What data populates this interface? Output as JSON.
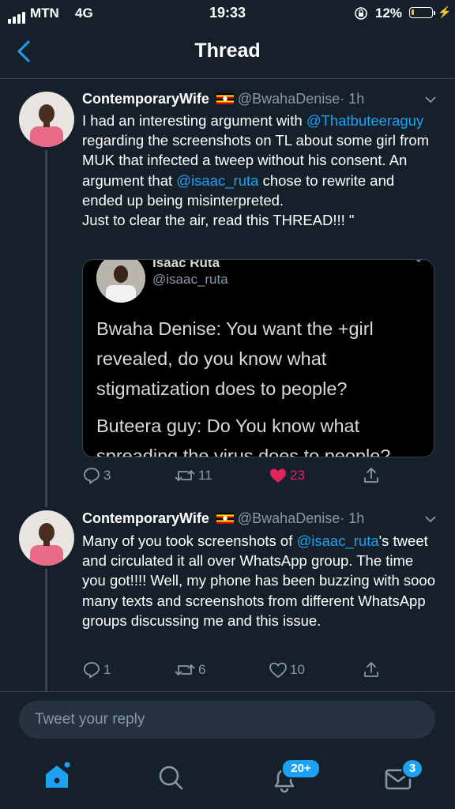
{
  "status_bar": {
    "carrier": "MTN",
    "network": "4G",
    "time": "19:33",
    "battery_percent": "12%",
    "battery_level": 0.12
  },
  "header": {
    "title": "Thread"
  },
  "tweets": [
    {
      "display_name": "ContemporaryWife",
      "handle": "@BwahaDenise",
      "time": "· 1h",
      "text_segments": [
        {
          "t": "I had an interesting argument with "
        },
        {
          "t": "@Thatbuteeraguy",
          "mention": true
        },
        {
          "t": " regarding the screenshots on TL about some girl from MUK that infected a tweep without his consent. An argument that "
        },
        {
          "t": "@isaac_ruta",
          "mention": true
        },
        {
          "t": " chose to rewrite and ended up being misinterpreted."
        }
      ],
      "text_last_line": "Just to clear the air, read this THREAD!!! \"",
      "replies": "3",
      "retweets": "11",
      "likes": "23",
      "liked": true
    },
    {
      "display_name": "ContemporaryWife",
      "handle": "@BwahaDenise",
      "time": "· 1h",
      "text_segments": [
        {
          "t": "Many of you took screenshots of "
        },
        {
          "t": "@isaac_ruta",
          "mention": true
        },
        {
          "t": "'s tweet and circulated it all over WhatsApp group. The time you got!!!! Well, my phone has been buzzing with sooo many texts and screenshots from different WhatsApp groups discussing me and this issue."
        }
      ],
      "replies": "1",
      "retweets": "6",
      "likes": "10",
      "liked": false
    }
  ],
  "quoted_image": {
    "name": "Isaac Ruta",
    "handle": "@isaac_ruta",
    "lines": [
      "Bwaha Denise: You want the +girl",
      "revealed, do you know what",
      "stigmatization does to people?",
      "Buteera guy: Do You know what",
      "spreading the virus does to people?"
    ]
  },
  "reply_bar": {
    "placeholder": "Tweet your reply"
  },
  "tab_bar": {
    "notifications_badge": "20+",
    "messages_badge": "3"
  },
  "colors": {
    "background": "#15202b",
    "accent": "#1da1f2",
    "like": "#e0245e",
    "muted": "#8899a6"
  }
}
